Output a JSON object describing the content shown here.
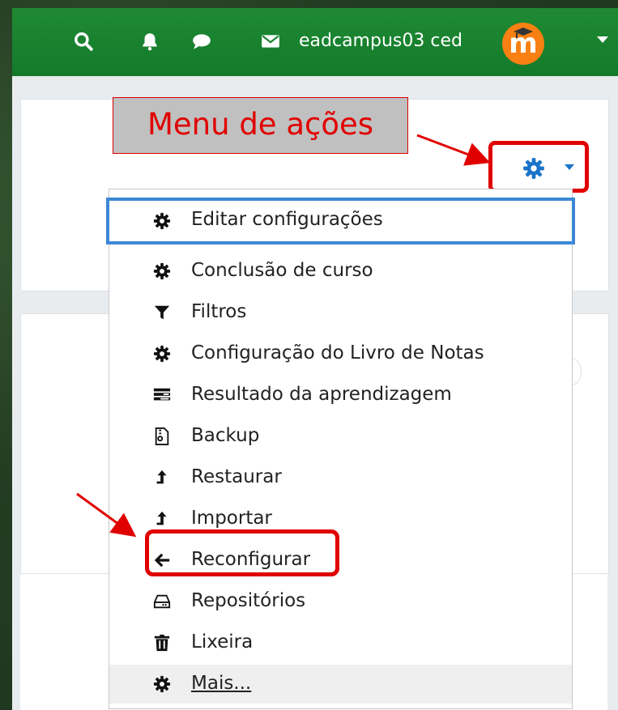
{
  "navbar": {
    "username": "eadcampus03 ced",
    "avatar_letter": "m",
    "icons": [
      "search-icon",
      "bell-icon",
      "chat-bubble-icon",
      "envelope-icon",
      "chevron-down-icon"
    ],
    "brand_color": "#1a8430"
  },
  "annotation": {
    "label": "Menu de ações",
    "color": "#e00000"
  },
  "actions_button": {
    "icon": "gear-icon",
    "color": "#1a73c8"
  },
  "menu": {
    "items": [
      {
        "label": "Editar configurações",
        "icon": "gear-icon"
      },
      {
        "label": "Conclusão de curso",
        "icon": "gear-icon"
      },
      {
        "label": "Filtros",
        "icon": "filter-icon"
      },
      {
        "label": "Configuração do Livro de Notas",
        "icon": "gear-icon"
      },
      {
        "label": "Resultado da aprendizagem",
        "icon": "list-icon"
      },
      {
        "label": "Backup",
        "icon": "file-archive-icon"
      },
      {
        "label": "Restaurar",
        "icon": "level-up-icon"
      },
      {
        "label": "Importar",
        "icon": "level-up-icon"
      },
      {
        "label": "Reconfigurar",
        "icon": "arrow-left-icon"
      },
      {
        "label": "Repositórios",
        "icon": "hard-drive-icon"
      },
      {
        "label": "Lixeira",
        "icon": "trash-icon"
      },
      {
        "label": "Mais...",
        "icon": "gear-icon"
      }
    ]
  }
}
